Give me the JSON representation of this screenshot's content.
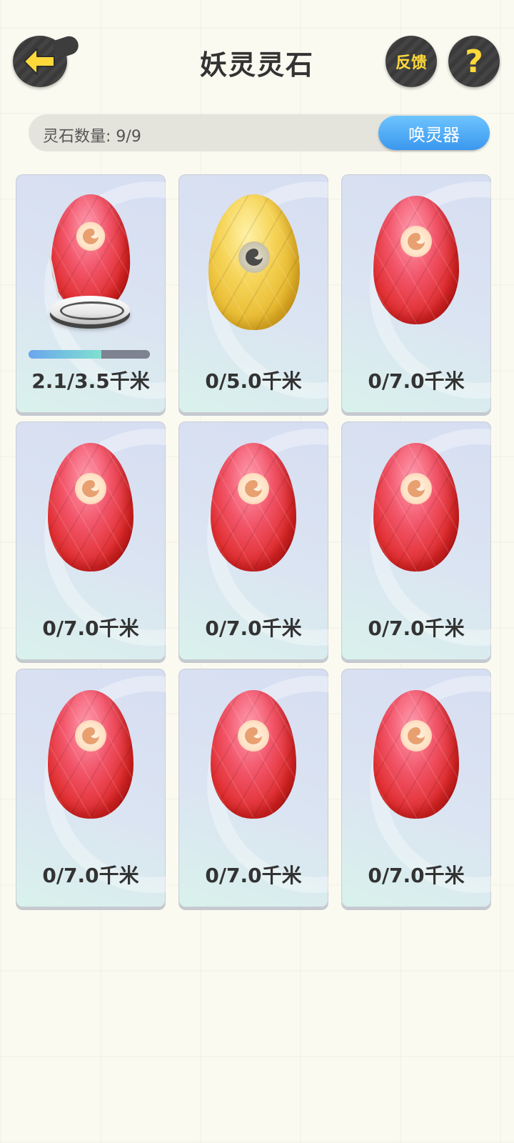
{
  "header": {
    "title": "妖灵灵石",
    "feedback_label": "反馈",
    "help_label": "?"
  },
  "stone_count": {
    "label": "灵石数量: 9/9",
    "summon_label": "唤灵器"
  },
  "colors": {
    "accent_blue": "#3a98ee",
    "icon_yellow": "#ffd93a",
    "card_bg": "#dbe4f2"
  },
  "stones": [
    {
      "egg": "red-egg",
      "distance": "2.1/3.5千米",
      "incubating": true,
      "progress": 0.6
    },
    {
      "egg": "gold-egg",
      "distance": "0/5.0千米",
      "incubating": false
    },
    {
      "egg": "red-egg",
      "distance": "0/7.0千米",
      "incubating": false
    },
    {
      "egg": "red-egg",
      "distance": "0/7.0千米",
      "incubating": false
    },
    {
      "egg": "red-egg",
      "distance": "0/7.0千米",
      "incubating": false
    },
    {
      "egg": "red-egg",
      "distance": "0/7.0千米",
      "incubating": false
    },
    {
      "egg": "red-egg",
      "distance": "0/7.0千米",
      "incubating": false
    },
    {
      "egg": "red-egg",
      "distance": "0/7.0千米",
      "incubating": false
    },
    {
      "egg": "red-egg",
      "distance": "0/7.0千米",
      "incubating": false
    }
  ]
}
